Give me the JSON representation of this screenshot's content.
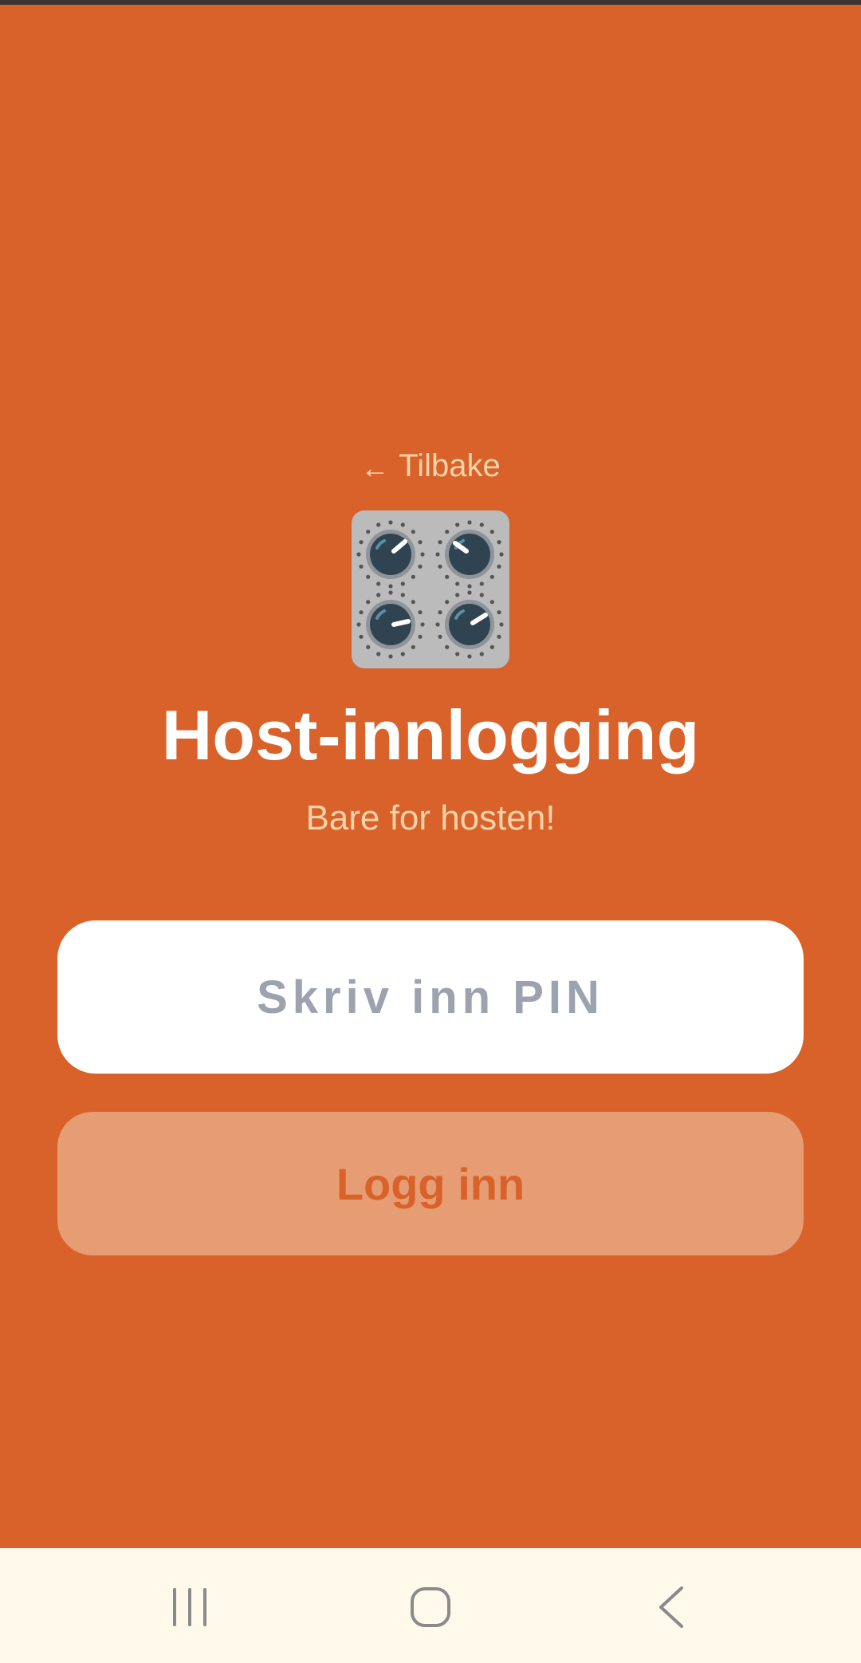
{
  "header": {
    "back_label": "Tilbake",
    "back_arrow": "←",
    "logo_icon": "control-knobs-icon"
  },
  "main": {
    "title": "Host-innlogging",
    "subtitle": "Bare for hosten!",
    "pin_placeholder": "Skriv inn PIN",
    "pin_value": "",
    "login_label": "Logg inn"
  },
  "nav": {
    "recents_icon": "recents-icon",
    "home_icon": "home-icon",
    "back_icon": "back-chevron-icon"
  },
  "colors": {
    "background": "#D9622B",
    "accent_text": "#F8D2A8",
    "button_fill": "#E69D74",
    "nav_background": "#FEF9EA"
  }
}
